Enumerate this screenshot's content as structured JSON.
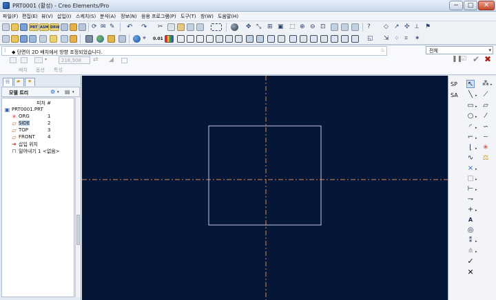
{
  "window": {
    "title": "PRT0001 (활성) - Creo Elements/Pro",
    "minimize": "−",
    "maximize": "□",
    "close": "✕"
  },
  "menu": [
    "파일(F)",
    "편집(E)",
    "뷰(V)",
    "삽입(I)",
    "스케치(S)",
    "분석(A)",
    "정보(N)",
    "응용 프로그램(P)",
    "도구(T)",
    "창(W)",
    "도움말(H)"
  ],
  "toolbar": {
    "prt_label": "PRT",
    "asm_label": "ASM",
    "drw_label": "DRW",
    "value_label": "0.01"
  },
  "dashboard": {
    "message": "◆ 단면이 2D 배치에서 방향 조정되었습니다.",
    "filter_value": "전체",
    "dimension_value": "216,508",
    "tabs": [
      "배치",
      "옵션",
      "특성"
    ]
  },
  "model_tree": {
    "title": "모델 트리",
    "column_header": "피처 #",
    "root": "PRT0001.PRT",
    "items": [
      {
        "label": "ORG",
        "num": "1",
        "icon": "datum-csys-icon"
      },
      {
        "label": "SIDE",
        "num": "2",
        "icon": "datum-plane-icon"
      },
      {
        "label": "TOP",
        "num": "3",
        "icon": "datum-plane-icon"
      },
      {
        "label": "FRONT",
        "num": "4",
        "icon": "datum-plane-icon"
      },
      {
        "label": "삽입 위치",
        "num": "",
        "icon": "insert-here-icon"
      },
      {
        "label": "밀어내기 1",
        "num": "<없음>",
        "icon": "extrude-icon"
      }
    ]
  },
  "right_panel": {
    "labels": [
      "SP",
      "SA"
    ]
  },
  "colors": {
    "canvas_bg": "#061637",
    "datum_line": "#d9854a",
    "sketch_line": "#c7cbe6",
    "accent": "#3c7bd4"
  }
}
